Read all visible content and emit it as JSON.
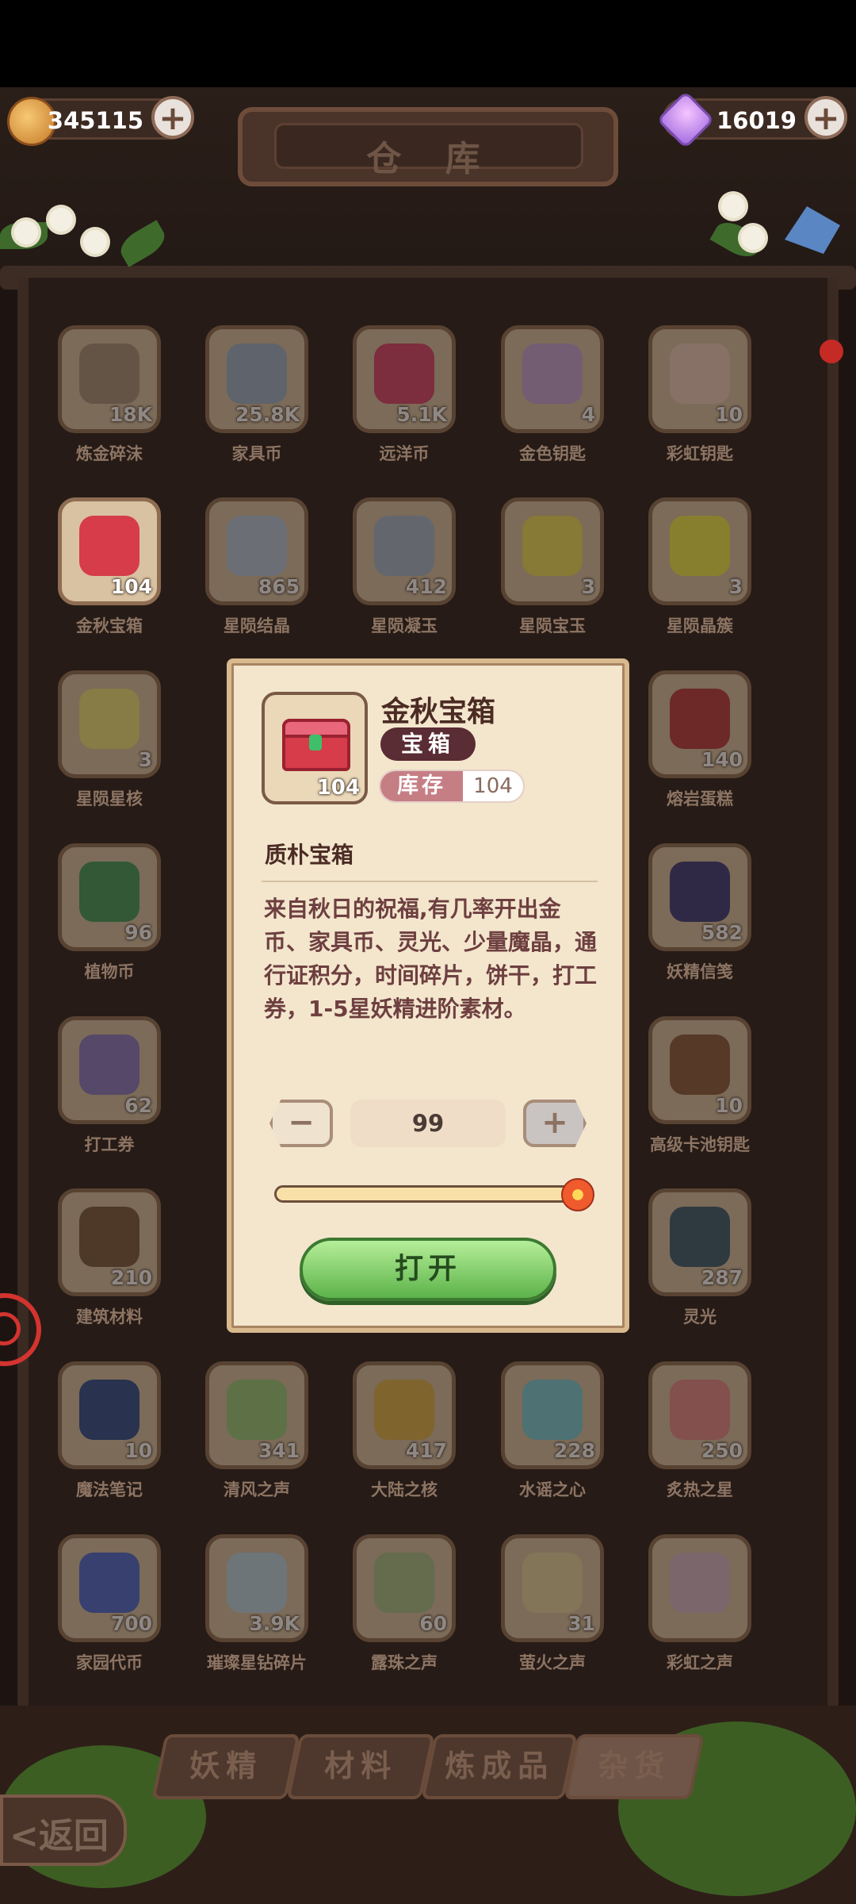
{
  "header": {
    "title": "仓 库",
    "coins": "345115",
    "gems": "16019"
  },
  "items": [
    {
      "name": "炼金碎沫",
      "count": "18K",
      "icon": "rock-pile-icon",
      "color": "#a8937a"
    },
    {
      "name": "家具币",
      "count": "25.8K",
      "icon": "furniture-coin-icon",
      "color": "#9db1c9"
    },
    {
      "name": "远洋币",
      "count": "5.1K",
      "icon": "ocean-coin-icon",
      "color": "#d9416a"
    },
    {
      "name": "金色钥匙",
      "count": "4",
      "icon": "gold-key-icon",
      "color": "#c7a6d9"
    },
    {
      "name": "彩虹钥匙",
      "count": "10",
      "icon": "rainbow-key-icon",
      "color": "#f0d0c0"
    },
    {
      "name": "金秋宝箱",
      "count": "104",
      "icon": "treasure-chest-icon",
      "color": "#d63c4a"
    },
    {
      "name": "星陨结晶",
      "count": "865",
      "icon": "crystal-icon",
      "color": "#b7c8dc"
    },
    {
      "name": "星陨凝玉",
      "count": "412",
      "icon": "star-jade-icon",
      "color": "#a9b9cc"
    },
    {
      "name": "星陨宝玉",
      "count": "3",
      "icon": "gem-icon",
      "color": "#f0e05a"
    },
    {
      "name": "星陨晶簇",
      "count": "3",
      "icon": "star-cluster-icon",
      "color": "#f2ec4a"
    },
    {
      "name": "星陨星核",
      "count": "3",
      "icon": "star-core-icon",
      "color": "#f1e37a"
    },
    {
      "name": "",
      "count": "",
      "icon": "",
      "color": ""
    },
    {
      "name": "",
      "count": "",
      "icon": "",
      "color": ""
    },
    {
      "name": "",
      "count": "",
      "icon": "",
      "color": ""
    },
    {
      "name": "熔岩蛋糕",
      "count": "140",
      "icon": "lava-cake-icon",
      "color": "#b8393a"
    },
    {
      "name": "植物币",
      "count": "96",
      "icon": "plant-coin-icon",
      "color": "#3f9a5a"
    },
    {
      "name": "",
      "count": "",
      "icon": "",
      "color": ""
    },
    {
      "name": "",
      "count": "",
      "icon": "",
      "color": ""
    },
    {
      "name": "",
      "count": "",
      "icon": "",
      "color": ""
    },
    {
      "name": "妖精信笺",
      "count": "582",
      "icon": "letter-icon",
      "color": "#3b3a7a"
    },
    {
      "name": "打工券",
      "count": "62",
      "icon": "ticket-icon",
      "color": "#8a79c2"
    },
    {
      "name": "",
      "count": "",
      "icon": "",
      "color": ""
    },
    {
      "name": "",
      "count": "",
      "icon": "",
      "color": ""
    },
    {
      "name": "",
      "count": "",
      "icon": "",
      "color": ""
    },
    {
      "name": "高级卡池钥匙",
      "count": "10",
      "icon": "card-key-icon",
      "color": "#8a5a3a"
    },
    {
      "name": "建筑材料",
      "count": "210",
      "icon": "building-material-icon",
      "color": "#7a5a3e"
    },
    {
      "name": "",
      "count": "",
      "icon": "",
      "color": ""
    },
    {
      "name": "",
      "count": "",
      "icon": "",
      "color": ""
    },
    {
      "name": "",
      "count": "",
      "icon": "",
      "color": ""
    },
    {
      "name": "灵光",
      "count": "287",
      "icon": "aura-icon",
      "color": "#3a5a6e"
    },
    {
      "name": "魔法笔记",
      "count": "10",
      "icon": "notebook-icon",
      "color": "#2d4c8c"
    },
    {
      "name": "清风之声",
      "count": "341",
      "icon": "wind-icon",
      "color": "#9ccf7a"
    },
    {
      "name": "大陆之核",
      "count": "417",
      "icon": "earth-core-icon",
      "color": "#e0b54a"
    },
    {
      "name": "水谣之心",
      "count": "228",
      "icon": "water-heart-icon",
      "color": "#7ad0d8"
    },
    {
      "name": "炙热之星",
      "count": "250",
      "icon": "fire-star-icon",
      "color": "#e88a8a"
    },
    {
      "name": "家园代币",
      "count": "700",
      "icon": "home-token-icon",
      "color": "#4a6ad0"
    },
    {
      "name": "璀璨星钻碎片",
      "count": "3.9K",
      "icon": "diamond-shard-icon",
      "color": "#bcd8e6"
    },
    {
      "name": "露珠之声",
      "count": "60",
      "icon": "dew-bottle-icon",
      "color": "#a8c48a"
    },
    {
      "name": "萤火之声",
      "count": "31",
      "icon": "firefly-bottle-icon",
      "color": "#e8d8a0"
    },
    {
      "name": "彩虹之声",
      "count": "",
      "icon": "rainbow-bottle-icon",
      "color": "#d8b8c8"
    }
  ],
  "modal": {
    "item_name": "金秋宝箱",
    "type": "宝箱",
    "stock_label": "库存",
    "stock_value": "104",
    "icon_count": "104",
    "quality": "质朴宝箱",
    "description": "来自秋日的祝福,有几率开出金币、家具币、灵光、少量魔晶，通行证积分，时间碎片，饼干，打工券，1-5星妖精进阶素材。",
    "quantity": "99",
    "minus": "−",
    "plus": "+",
    "slider_fraction": 1.0,
    "open_label": "打开"
  },
  "tabs": [
    {
      "label": "妖精"
    },
    {
      "label": "材料"
    },
    {
      "label": "炼成品"
    },
    {
      "label": "杂货",
      "active": true
    }
  ],
  "back_label": "<返回"
}
